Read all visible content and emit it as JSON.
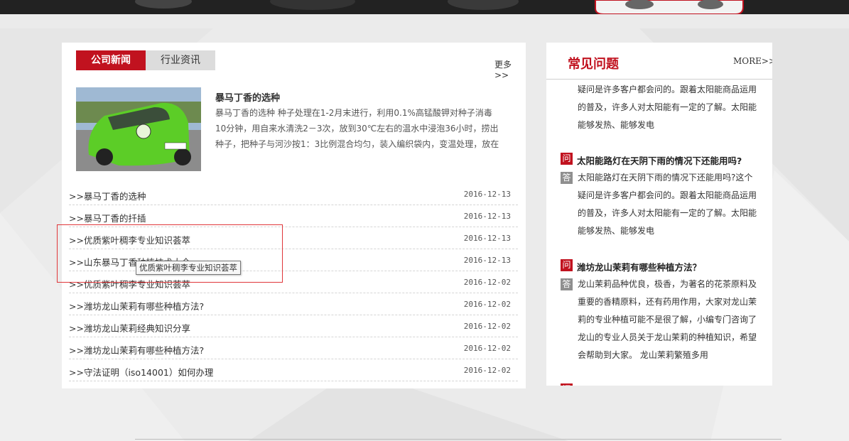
{
  "news": {
    "tabs": [
      {
        "label": "公司新闻"
      },
      {
        "label": "行业资讯"
      }
    ],
    "more_label": "更多>>",
    "feature": {
      "title": "暴马丁香的选种",
      "description": "暴马丁香的选种 种子处理在1-2月末进行，利用0.1%高锰酸钾对种子消毒10分钟，用自来水清洗2－3次，放到30℃左右的温水中浸泡36小时，捞出种子，把种子与河沙按1：3比例混合均匀，装入编织袋内，变温处理，放在",
      "image_alt": "绿色汽车"
    },
    "items": [
      {
        "title": ">>暴马丁香的选种",
        "date": "2016-12-13"
      },
      {
        "title": ">>暴马丁香的扦插",
        "date": "2016-12-13"
      },
      {
        "title": ">>优质紫叶稠李专业知识荟萃",
        "date": "2016-12-13"
      },
      {
        "title": ">>山东暴马丁香种植技术大全",
        "date": "2016-12-13"
      },
      {
        "title": ">>优质紫叶稠李专业知识荟萃",
        "date": "2016-12-02"
      },
      {
        "title": ">>潍坊龙山茉莉有哪些种植方法?",
        "date": "2016-12-02"
      },
      {
        "title": ">>潍坊龙山茉莉经典知识分享",
        "date": "2016-12-02"
      },
      {
        "title": ">>潍坊龙山茉莉有哪些种植方法?",
        "date": "2016-12-02"
      },
      {
        "title": ">>守法证明（iso14001）如何办理",
        "date": "2016-12-02"
      }
    ],
    "tooltip": "优质紫叶稠李专业知识荟萃"
  },
  "faq": {
    "title": "常见问题",
    "more_label": "MORE>>",
    "q_char": "问",
    "a_char": "答",
    "partial_answer": "疑问是许多客户都会问的。跟着太阳能商品运用的普及，许多人对太阳能有一定的了解。太阳能能够发热、能够发电",
    "entries": [
      {
        "question": "太阳能路灯在天阴下雨的情况下还能用吗?",
        "answer": "太阳能路灯在天阴下雨的情况下还能用吗?这个疑问是许多客户都会问的。跟着太阳能商品运用的普及，许多人对太阳能有一定的了解。太阳能能够发热、能够发电"
      },
      {
        "question": "潍坊龙山茉莉有哪些种植方法？",
        "answer": "龙山茉莉品种优良，极香，为著名的花茶原料及重要的香精原料，还有药用作用，大家对龙山茉莉的专业种植可能不是很了解，小编专门咨询了龙山的专业人员关于龙山茉莉的种植知识，希望会帮助到大家。 龙山茉莉繁殖多用"
      }
    ]
  },
  "colors": {
    "accent": "#c1121f",
    "tab_inactive": "#dcdcdc",
    "answer_badge": "#8f8f8f"
  }
}
